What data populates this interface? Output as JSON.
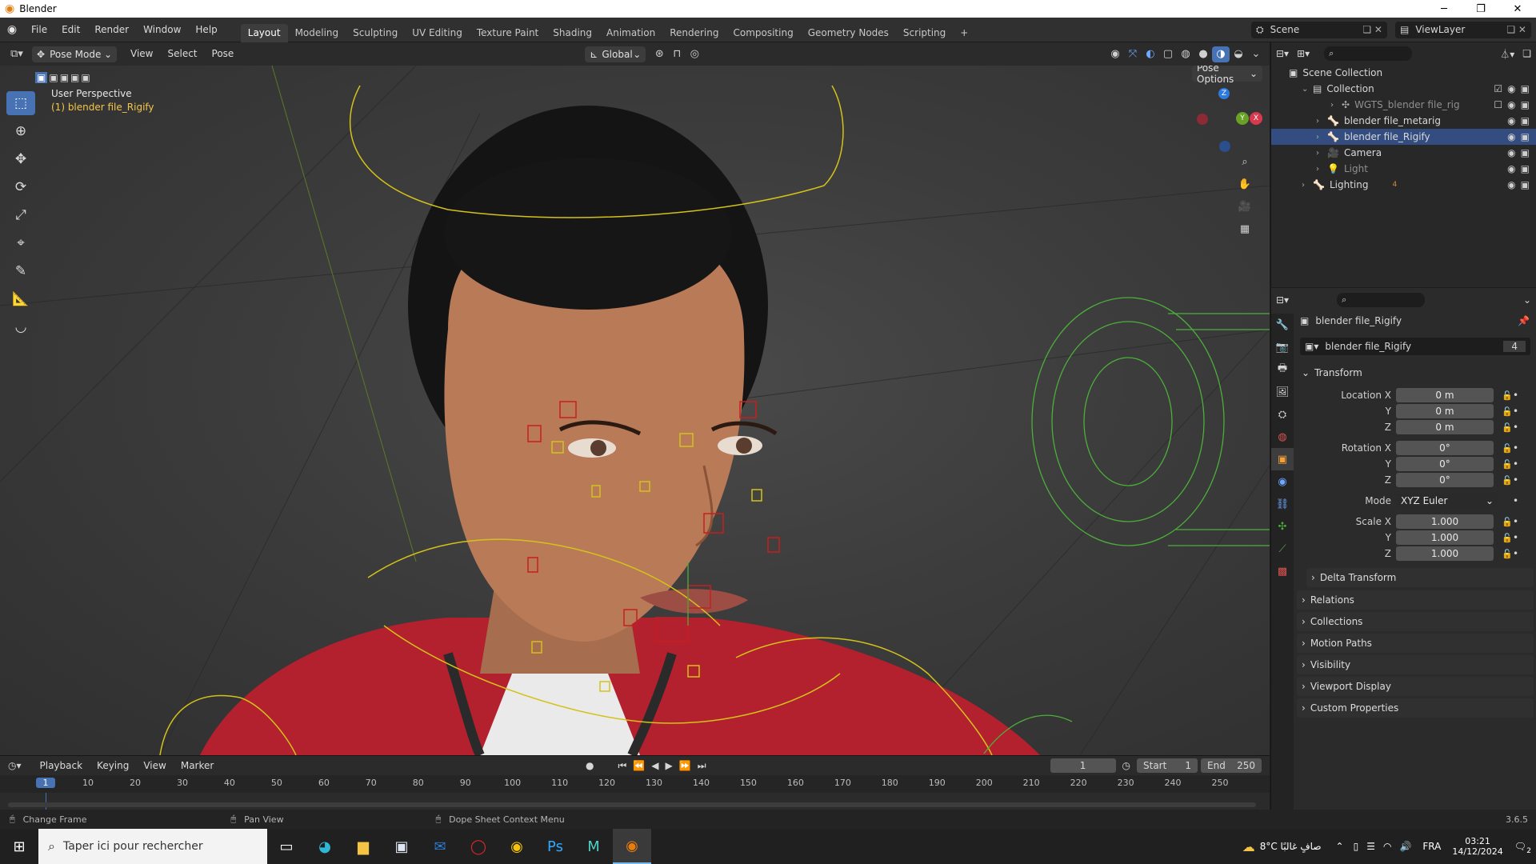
{
  "window": {
    "app_name": "Blender",
    "minimize": "─",
    "restore": "❐",
    "close": "✕"
  },
  "menus": [
    "File",
    "Edit",
    "Render",
    "Window",
    "Help"
  ],
  "workspaces": [
    "Layout",
    "Modeling",
    "Sculpting",
    "UV Editing",
    "Texture Paint",
    "Shading",
    "Animation",
    "Rendering",
    "Compositing",
    "Geometry Nodes",
    "Scripting",
    "+"
  ],
  "active_workspace": "Layout",
  "scene": {
    "name": "Scene",
    "view_layer": "ViewLayer"
  },
  "viewport_header": {
    "mode": "Pose Mode",
    "menus": [
      "View",
      "Select",
      "Pose"
    ],
    "transform_orientation": "Global",
    "pose_options": "Pose Options"
  },
  "viewport": {
    "perspective": "User Perspective",
    "object_info": "(1) blender file_Rigify",
    "gizmo": {
      "z": "Z",
      "y": "Y",
      "x": "X"
    }
  },
  "outliner": {
    "root": "Scene Collection",
    "items": [
      {
        "label": "Collection",
        "indent": 1
      },
      {
        "label": "WGTS_blender file_rig",
        "indent": 3
      },
      {
        "label": "blender file_metarig",
        "indent": 2
      },
      {
        "label": "blender file_Rigify",
        "indent": 2,
        "selected": true
      },
      {
        "label": "Camera",
        "indent": 2
      },
      {
        "label": "Light",
        "indent": 2
      },
      {
        "label": "Lighting",
        "indent": 1,
        "badge": "4"
      }
    ]
  },
  "properties": {
    "object_name": "blender file_Rigify",
    "data_name": "blender file_Rigify",
    "users": "4",
    "transform_title": "Transform",
    "location_label": "Location X",
    "rotation_label": "Rotation X",
    "scale_label": "Scale X",
    "y_label": "Y",
    "z_label": "Z",
    "location": [
      "0 m",
      "0 m",
      "0 m"
    ],
    "rotation": [
      "0°",
      "0°",
      "0°"
    ],
    "mode_label": "Mode",
    "mode_value": "XYZ Euler",
    "scale": [
      "1.000",
      "1.000",
      "1.000"
    ],
    "delta_transform": "Delta Transform",
    "panels": [
      "Relations",
      "Collections",
      "Motion Paths",
      "Visibility",
      "Viewport Display",
      "Custom Properties"
    ]
  },
  "timeline": {
    "menus": [
      "Playback",
      "Keying",
      "View",
      "Marker"
    ],
    "current_frame": "1",
    "start_label": "Start",
    "start": "1",
    "end_label": "End",
    "end": "250",
    "ruler": [
      "1",
      "10",
      "20",
      "30",
      "40",
      "50",
      "60",
      "70",
      "80",
      "90",
      "100",
      "110",
      "120",
      "130",
      "140",
      "150",
      "160",
      "170",
      "180",
      "190",
      "200",
      "210",
      "220",
      "230",
      "240",
      "250"
    ]
  },
  "statusbar": {
    "hint1": "Change Frame",
    "hint2": "Pan View",
    "hint3": "Dope Sheet Context Menu",
    "version": "3.6.5"
  },
  "taskbar": {
    "search_placeholder": "Taper ici pour rechercher",
    "weather": "8°C  صافٍ غالبًا",
    "language": "FRA",
    "time": "03:21",
    "date": "14/12/2024",
    "notification_count": "2"
  },
  "colors": {
    "accent": "#4772b3",
    "selection": "#334d80",
    "bone_yellow": "#d4c21a",
    "bone_red": "#c81e1e",
    "bone_green": "#4caf3a"
  }
}
